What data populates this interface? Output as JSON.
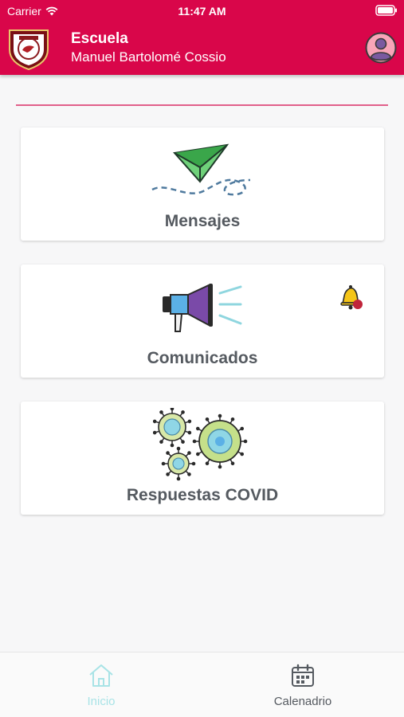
{
  "status_bar": {
    "carrier": "Carrier",
    "time": "11:47 AM"
  },
  "header": {
    "title": "Escuela",
    "subtitle": "Manuel Bartolomé Cossio",
    "background_color": "#d9064a"
  },
  "cards": [
    {
      "label": "Mensajes",
      "icon": "paper-plane-icon"
    },
    {
      "label": "Comunicados",
      "icon": "megaphone-icon",
      "notification_icon": "bell-icon"
    },
    {
      "label": "Respuestas COVID",
      "icon": "virus-icon"
    }
  ],
  "tabbar": {
    "items": [
      {
        "label": "Inicio",
        "icon": "home-icon",
        "active": true,
        "color": "#a8e3e6"
      },
      {
        "label": "Calenadrio",
        "icon": "calendar-icon",
        "active": false,
        "color": "#555a60"
      }
    ]
  }
}
